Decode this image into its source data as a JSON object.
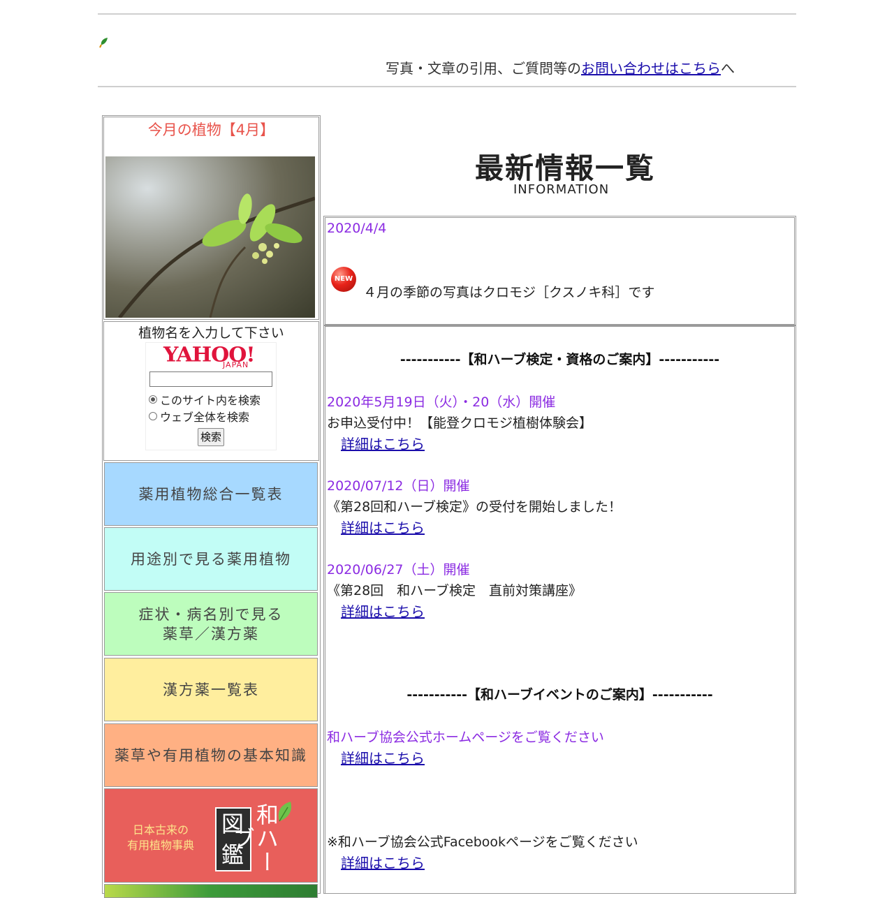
{
  "header": {
    "notice_prefix": "写真・文章の引用、ご質問等の",
    "notice_link": "お問い合わせはこちら",
    "notice_suffix": "へ"
  },
  "sidebar": {
    "month_title": "今月の植物【4月】",
    "search": {
      "label": "植物名を入力して下さい",
      "logo": "YAHOO!",
      "logo_sub": "JAPAN",
      "radio_site": "このサイト内を検索",
      "radio_web": "ウェブ全体を検索",
      "button": "検索",
      "selected": "このサイト内を検索"
    },
    "nav": [
      {
        "line1": "薬用植物総合一覧表",
        "line2": "",
        "color": "#a7d9ff"
      },
      {
        "line1": "用途別で見る薬用植物",
        "line2": "",
        "color": "#c2fdf6"
      },
      {
        "line1": "症状・病名別で見る",
        "line2": "薬草／漢方薬",
        "color": "#bdfdbd"
      },
      {
        "line1": "漢方薬一覧表",
        "line2": "",
        "color": "#ffee9e"
      },
      {
        "line1": "薬草や有用植物の基本知識",
        "line2": "",
        "color": "#ffb083"
      }
    ],
    "zukan": {
      "desc_line1": "日本古来の",
      "desc_line2": "有用植物事典",
      "kanji1": "図",
      "kanji2": "鑑",
      "kana": "和ハーブ",
      "color": "#e85f5b"
    }
  },
  "main": {
    "title": "最新情報一覧",
    "subtitle": "INFORMATION",
    "latest": {
      "date": "2020/4/4",
      "badge": "NEW",
      "text": "４月の季節の写真はクロモジ［クスノキ科］です"
    },
    "section1_heading": "-----------【和ハーブ検定・資格のご案内】-----------",
    "items": [
      {
        "date": "2020年5月19日（火）・20（水）開催",
        "text": "お申込受付中！【能登クロモジ植樹体験会】",
        "link": "詳細はこちら"
      },
      {
        "date": "2020/07/12（日）開催",
        "text": "《第28回和ハーブ検定》の受付を開始しました！",
        "link": "詳細はこちら"
      },
      {
        "date": "2020/06/27（土）開催",
        "text": "《第28回　和ハーブ検定　直前対策講座》",
        "link": "詳細はこちら"
      }
    ],
    "section2_heading": "-----------【和ハーブイベントのご案内】-----------",
    "event": {
      "text": "和ハーブ協会公式ホームページをご覧ください",
      "link": "詳細はこちら"
    },
    "facebook": {
      "text": "※和ハーブ協会公式Facebookページをご覧ください",
      "link": "詳細はこちら"
    }
  },
  "colors": {
    "accent_purple": "#8b2be2",
    "link": "#1a0dab",
    "month_title": "#e8534b"
  }
}
